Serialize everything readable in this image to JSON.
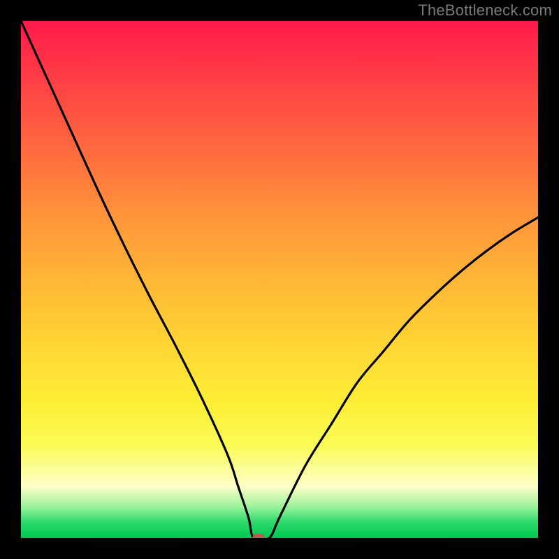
{
  "watermark": "TheBottleneck.com",
  "chart_data": {
    "type": "line",
    "title": "",
    "xlabel": "",
    "ylabel": "",
    "xlim": [
      0,
      100
    ],
    "ylim": [
      0,
      100
    ],
    "grid": false,
    "background_gradient": {
      "from": "#ff1a4b",
      "to": "#00c853",
      "mid": "#ffe13a"
    },
    "x": [
      0,
      5,
      10,
      15,
      20,
      25,
      30,
      35,
      40,
      42,
      44,
      45,
      48,
      50,
      55,
      60,
      65,
      70,
      75,
      80,
      85,
      90,
      95,
      100
    ],
    "values": [
      100,
      89,
      78,
      67,
      56.5,
      46.5,
      37,
      27,
      16,
      10,
      4,
      0,
      0,
      4,
      14,
      22,
      30,
      36,
      42,
      47,
      51.5,
      55.5,
      59,
      62
    ],
    "marker": {
      "x": 46,
      "y": 0,
      "color": "#c0564f"
    },
    "curve_color": "#000000"
  }
}
